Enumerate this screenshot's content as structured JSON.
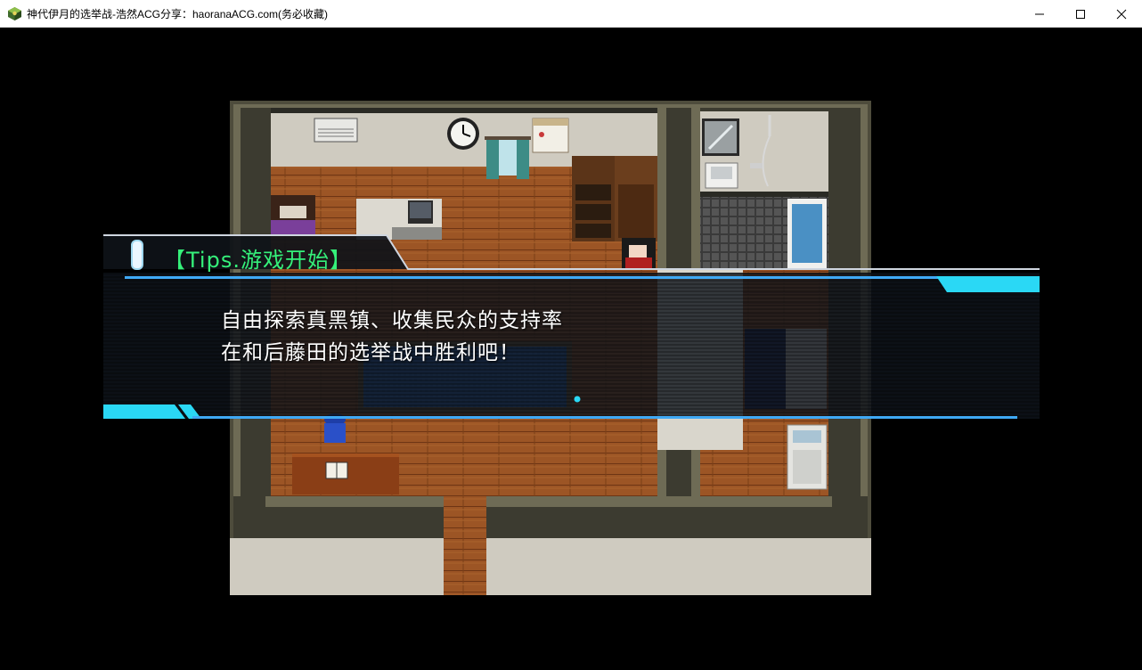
{
  "window": {
    "title": "神代伊月的选举战-浩然ACG分享：haoranaACG.com(务必收藏)",
    "icon": "game-app-icon",
    "controls": [
      "minimize-icon",
      "maximize-icon",
      "close-icon"
    ]
  },
  "scene": {
    "type": "top-down-house-interior",
    "objects": [
      "air-conditioner-icon",
      "wall-clock-icon",
      "window-curtain-icon",
      "calendar-icon",
      "bookshelf-icon",
      "wardrobe-icon",
      "bed-icon",
      "tv-desk-icon",
      "mirror-icon",
      "sink-icon",
      "shower-icon",
      "bathtub-icon",
      "blue-rug-icon",
      "blue-chair-icon",
      "desk-icon",
      "open-book-icon",
      "washing-machine-icon",
      "player-character-sprite"
    ]
  },
  "dialog": {
    "header": "【Tips.游戏开始】",
    "lines": [
      "自由探索真黑镇、收集民众的支持率",
      "在和后藤田的选举战中胜利吧！"
    ],
    "accent_color": "#2ad8f5",
    "header_color": "#35f07a"
  }
}
